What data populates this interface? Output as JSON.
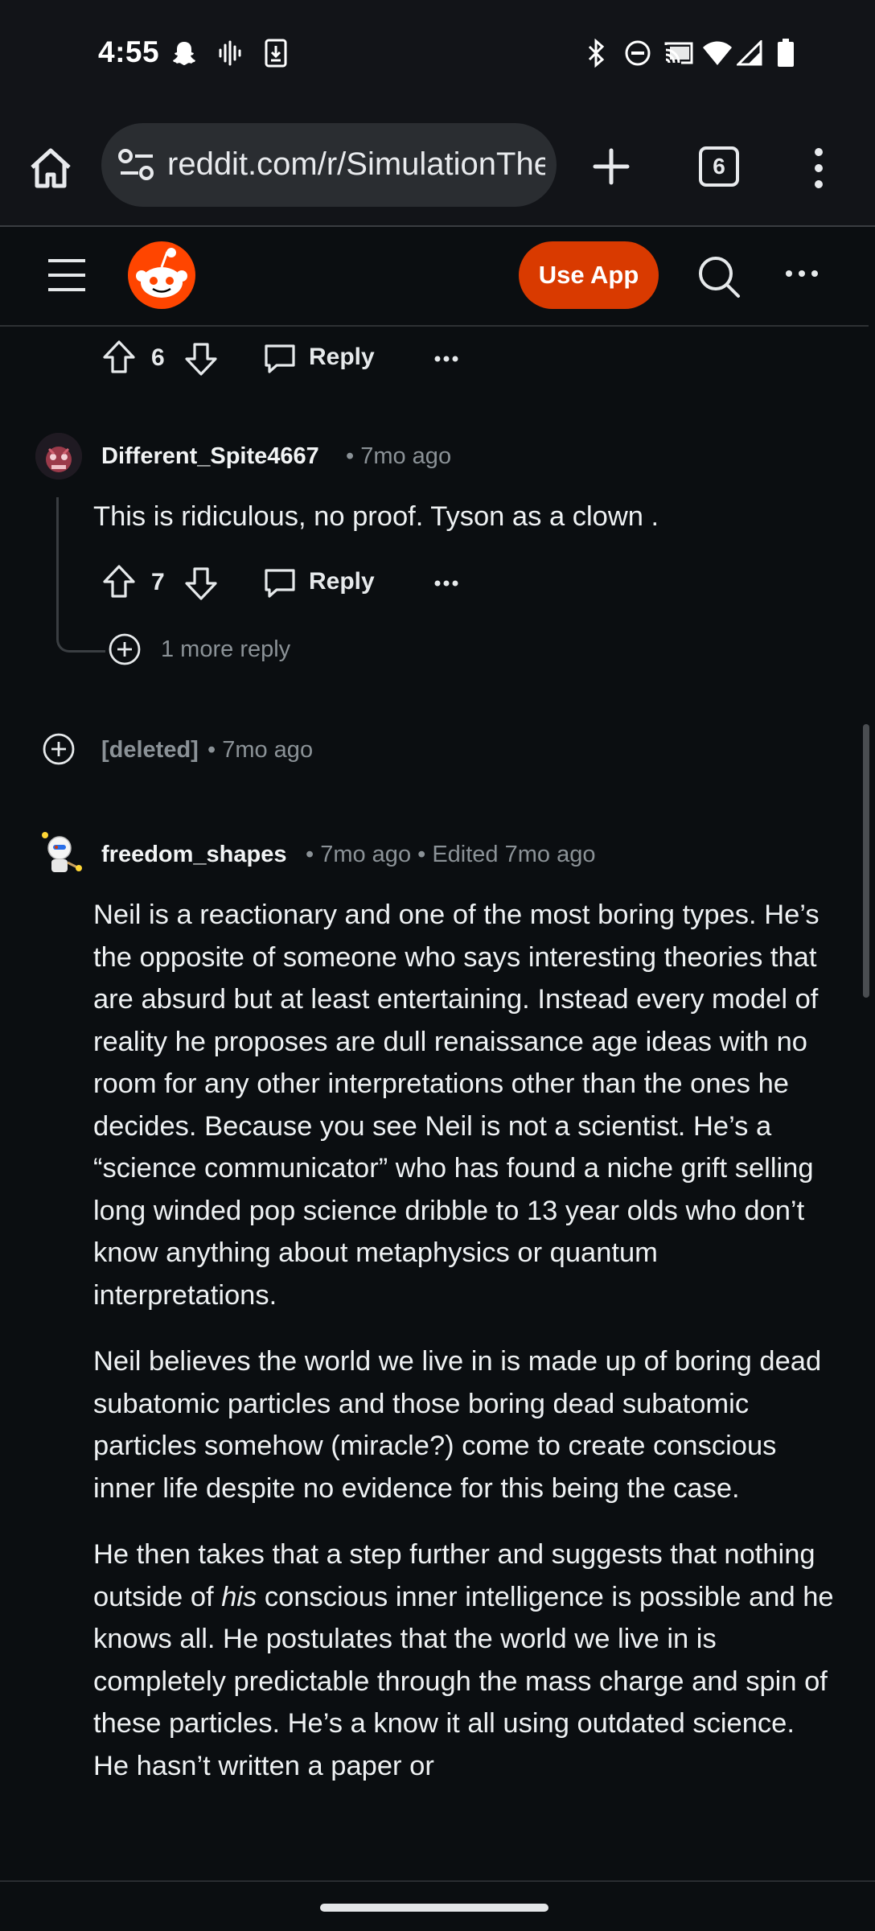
{
  "status_bar": {
    "time": "4:55",
    "left_icons": [
      "snapchat-icon",
      "audio-wave-icon",
      "download-icon"
    ],
    "right_icons": [
      "bluetooth-icon",
      "do-not-disturb-icon",
      "cast-icon",
      "wifi-icon",
      "signal-icon",
      "battery-icon"
    ]
  },
  "browser": {
    "url": "reddit.com/r/SimulationTheory",
    "tab_count": "6",
    "icons": [
      "home-icon",
      "site-settings-icon",
      "new-tab-icon",
      "tabs-icon",
      "menu-icon"
    ]
  },
  "reddit_header": {
    "use_app_label": "Use App",
    "icons": [
      "hamburger-menu-icon",
      "reddit-logo-icon",
      "search-icon",
      "more-options-icon"
    ],
    "accent_color": "#d93a00"
  },
  "comments": [
    {
      "votes": "6",
      "reply_label": "Reply"
    },
    {
      "username": "Different_Spite4667",
      "time": "• 7mo ago",
      "text": "This is ridiculous, no proof. Tyson as a clown .",
      "votes": "7",
      "reply_label": "Reply",
      "more_replies": "1 more reply"
    },
    {
      "username": "[deleted]",
      "time": "• 7mo ago"
    },
    {
      "username": "freedom_shapes",
      "time": "• 7mo ago • Edited 7mo ago",
      "paragraphs": [
        "Neil is a reactionary and one of the most boring types. He’s the opposite of someone who says interesting theories that are absurd but at least entertaining. Instead every model of reality he proposes are dull renaissance age ideas with no room for any other interpretations other than the ones he decides. Because you see Neil is not a scientist. He’s a “science communicator” who has found a niche grift selling long winded pop science dribble to 13 year olds who don’t know anything about metaphysics or quantum interpretations.",
        "Neil believes the world we live in is made up of boring dead subatomic particles and those boring dead subatomic particles somehow (miracle?) come to create conscious inner life despite no evidence for this being the case."
      ],
      "para3": {
        "before": "He then takes that a step further and suggests that nothing outside of ",
        "emph": "his",
        "after": " conscious inner intelligence is possible and he knows all. He postulates that the world we live in is completely predictable through the mass charge and spin of these particles. He’s a know it all using outdated science. He hasn’t written a paper or"
      }
    }
  ]
}
